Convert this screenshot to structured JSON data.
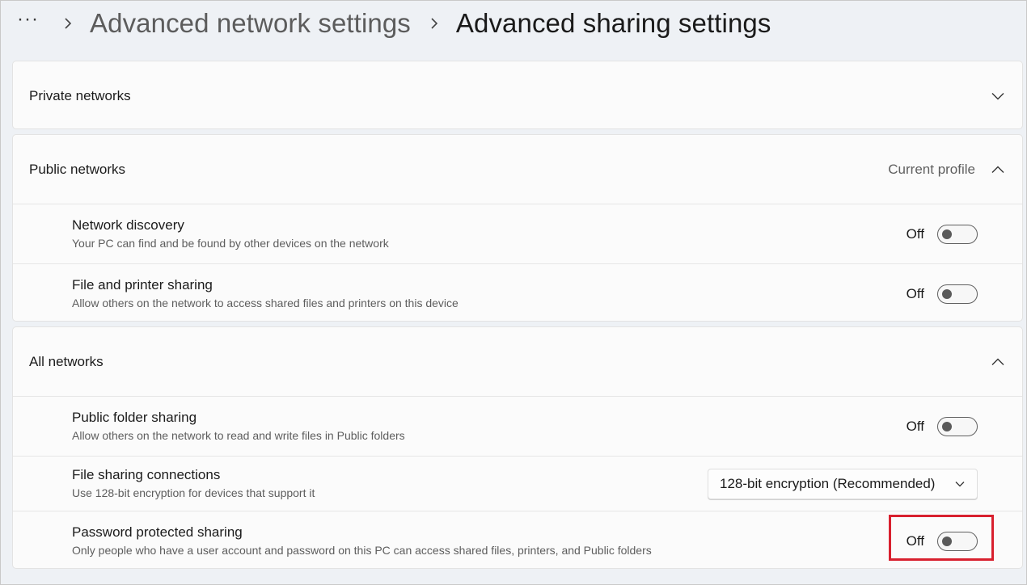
{
  "breadcrumb": {
    "more_glyph": "···",
    "previous": "Advanced network settings",
    "current": "Advanced sharing settings"
  },
  "private_networks": {
    "title": "Private networks",
    "expanded": false
  },
  "public_networks": {
    "title": "Public networks",
    "profile_label": "Current profile",
    "expanded": true,
    "settings": [
      {
        "title": "Network discovery",
        "description": "Your PC can find and be found by other devices on the network",
        "state_label": "Off",
        "on": false
      },
      {
        "title": "File and printer sharing",
        "description": "Allow others on the network to access shared files and printers on this device",
        "state_label": "Off",
        "on": false
      }
    ]
  },
  "all_networks": {
    "title": "All networks",
    "expanded": true,
    "public_folder_sharing": {
      "title": "Public folder sharing",
      "description": "Allow others on the network to read and write files in Public folders",
      "state_label": "Off",
      "on": false
    },
    "file_sharing_connections": {
      "title": "File sharing connections",
      "description": "Use 128-bit encryption for devices that support it",
      "selected": "128-bit encryption (Recommended)"
    },
    "password_protected_sharing": {
      "title": "Password protected sharing",
      "description": "Only people who have a user account and password on this PC can access shared files, printers, and Public folders",
      "state_label": "Off",
      "on": false
    }
  },
  "icons": {
    "breadcrumb_separator": "chevron-right-icon",
    "collapsed": "chevron-down-icon",
    "expanded": "chevron-up-icon",
    "dropdown": "chevron-down-icon"
  },
  "colors": {
    "highlight": "#d8202e",
    "toggle_off": "#5a5a5a"
  }
}
